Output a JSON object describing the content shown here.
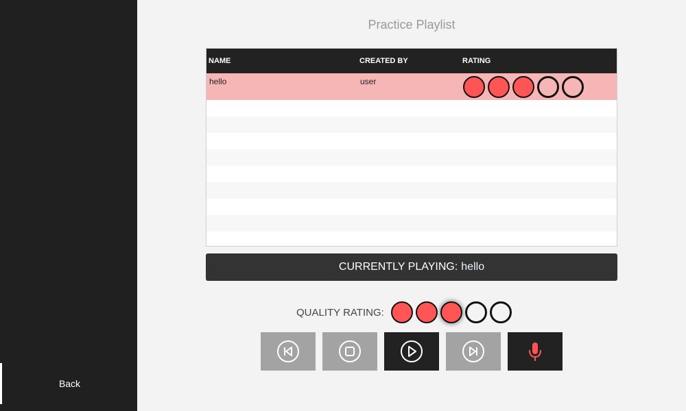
{
  "sidebar": {
    "back_label": "Back"
  },
  "page_title": "Practice Playlist",
  "table": {
    "columns": [
      "NAME",
      "CREATED BY",
      "RATING"
    ],
    "rows": [
      {
        "name": "hello",
        "created_by": "user",
        "rating": 3,
        "max_rating": 5
      }
    ]
  },
  "now_playing": {
    "label": "CURRENTLY PLAYING:",
    "song": "hello"
  },
  "quality": {
    "label": "QUALITY RATING:",
    "rating": 3,
    "max_rating": 5
  },
  "controls": [
    {
      "name": "previous-button",
      "icon": "skip-back-icon"
    },
    {
      "name": "stop-button",
      "icon": "stop-icon"
    },
    {
      "name": "play-button",
      "icon": "play-icon",
      "active": true
    },
    {
      "name": "next-button",
      "icon": "skip-forward-icon"
    },
    {
      "name": "record-button",
      "icon": "microphone-icon",
      "active": true
    }
  ],
  "colors": {
    "accent_red": "#ff5555",
    "selected_row": "#f7b6b6",
    "dark": "#222222",
    "control_gray": "#a3a3a3"
  }
}
